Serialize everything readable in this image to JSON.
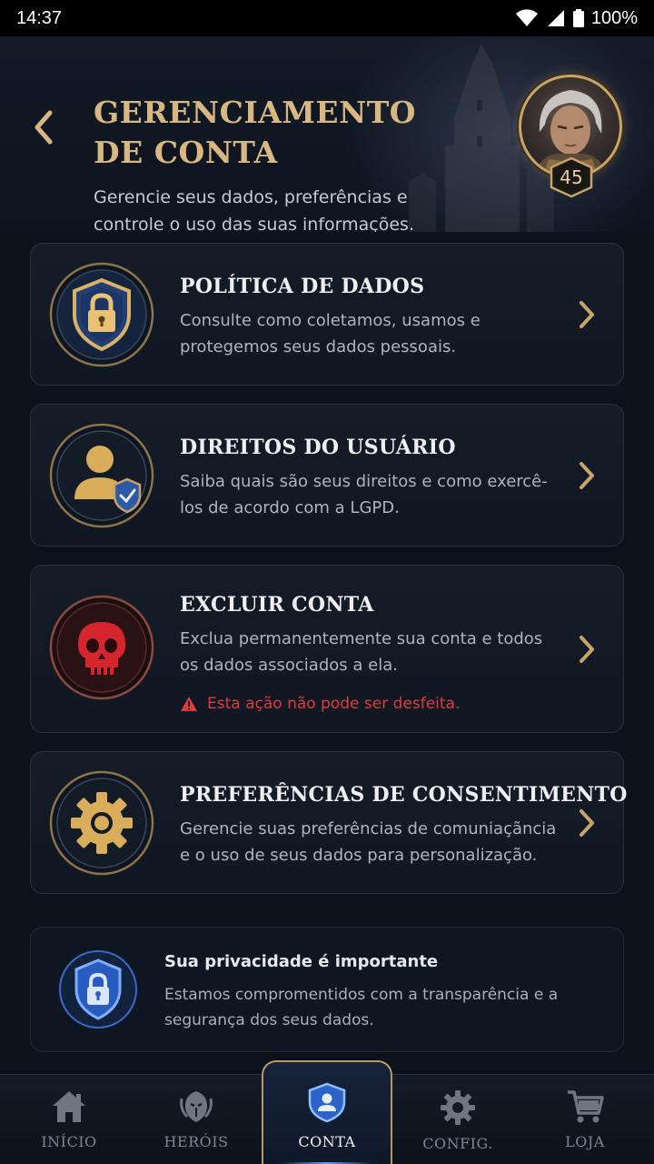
{
  "status_bar": {
    "time": "14:37",
    "battery": "100%"
  },
  "header": {
    "title": "GERENCIAMENTO DE CONTA",
    "subtitle": "Gerencie seus dados, preferências e controle o uso das suas informações.",
    "level": "45"
  },
  "cards": [
    {
      "title": "POLÍTICA DE DADOS",
      "description": "Consulte como coletamos, usamos e protegemos seus dados pessoais.",
      "icon": "shield-lock-icon"
    },
    {
      "title": "DIREITOS DO USUÁRIO",
      "description": "Saiba quais são seus direitos e como exercê-los de acordo com a LGPD.",
      "icon": "user-check-icon"
    },
    {
      "title": "EXCLUIR CONTA",
      "description": "Exclua permanentemente sua conta e todos os dados associados a ela.",
      "warning": "Esta ação não pode ser desfeita.",
      "icon": "skull-icon"
    },
    {
      "title": "PREFERÊNCIAS DE CONSENTIMENTO",
      "description": "Gerencie suas preferências de comuniaçãncia e o uso de seus dados para personalização.",
      "icon": "gear-icon"
    }
  ],
  "privacy_note": {
    "title": "Sua privacidade é importante",
    "description": "Estamos compromentidos com a transparência e a segurança dos seus dados."
  },
  "bottom_nav": [
    {
      "label": "INÍCIO",
      "icon": "home-icon"
    },
    {
      "label": "HERÓIS",
      "icon": "heroes-icon"
    },
    {
      "label": "CONTA",
      "icon": "account-shield-icon",
      "active": true
    },
    {
      "label": "CONFIG.",
      "icon": "gear-icon"
    },
    {
      "label": "LOJA",
      "icon": "cart-icon"
    }
  ],
  "colors": {
    "accent_gold": "#d9b781",
    "danger_red": "#e0393c",
    "active_blue": "#5aa2ff",
    "background": "#0b121c"
  }
}
